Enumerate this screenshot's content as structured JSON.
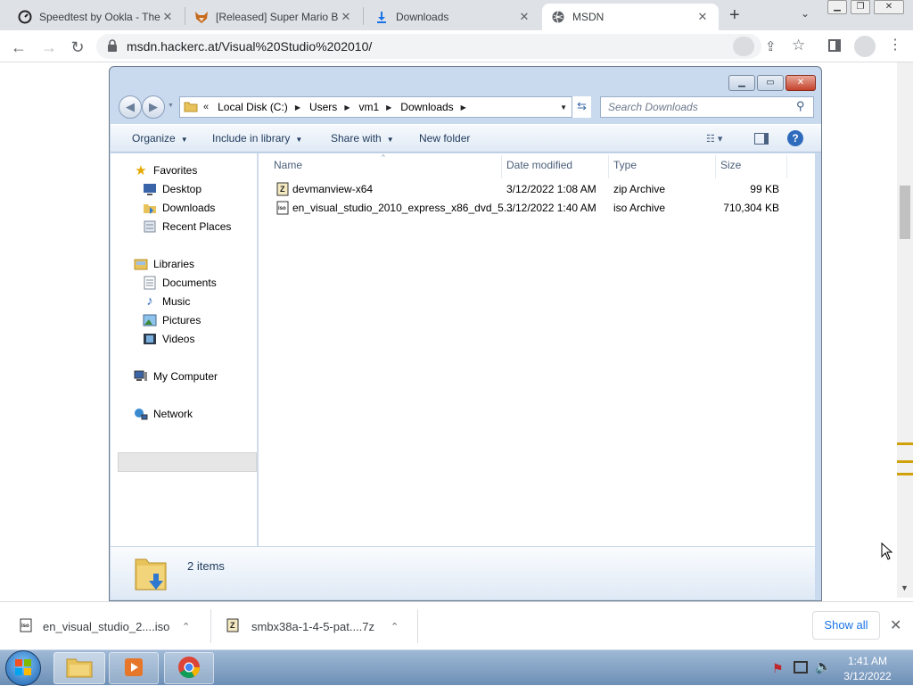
{
  "browser": {
    "tabs": [
      {
        "title": "Speedtest by Ookla - The",
        "icon": "speedtest-icon"
      },
      {
        "title": "[Released] Super Mario B",
        "icon": "fox-icon"
      },
      {
        "title": "Downloads",
        "icon": "download-icon"
      },
      {
        "title": "MSDN",
        "icon": "globe-icon"
      }
    ],
    "new_tab": "+",
    "url": "msdn.hackerc.at/Visual%20Studio%202010/"
  },
  "explorer": {
    "breadcrumb": [
      "Local Disk (C:)",
      "Users",
      "vm1",
      "Downloads"
    ],
    "search_placeholder": "Search Downloads",
    "commands": {
      "organize": "Organize",
      "include": "Include in library",
      "share": "Share with",
      "new_folder": "New folder"
    },
    "nav": {
      "favorites": "Favorites",
      "desktop": "Desktop",
      "downloads": "Downloads",
      "recent": "Recent Places",
      "libraries": "Libraries",
      "documents": "Documents",
      "music": "Music",
      "pictures": "Pictures",
      "videos": "Videos",
      "computer": "My Computer",
      "network": "Network"
    },
    "columns": {
      "name": "Name",
      "date": "Date modified",
      "type": "Type",
      "size": "Size"
    },
    "files": [
      {
        "name": "devmanview-x64",
        "date": "3/12/2022 1:08 AM",
        "type": "zip Archive",
        "size": "99 KB"
      },
      {
        "name": "en_visual_studio_2010_express_x86_dvd_5...",
        "date": "3/12/2022 1:40 AM",
        "type": "iso Archive",
        "size": "710,304 KB"
      }
    ],
    "status": "2 items"
  },
  "downloads_bar": {
    "items": [
      {
        "name": "en_visual_studio_2....iso"
      },
      {
        "name": "smbx38a-1-4-5-pat....7z"
      }
    ],
    "show_all": "Show all"
  },
  "taskbar": {
    "time": "1:41 AM",
    "date": "3/12/2022"
  },
  "colors": {
    "explorer_frame": "#c9d9ee",
    "link_blue": "#1a73e8",
    "taskbar": "#7f9fc4"
  }
}
